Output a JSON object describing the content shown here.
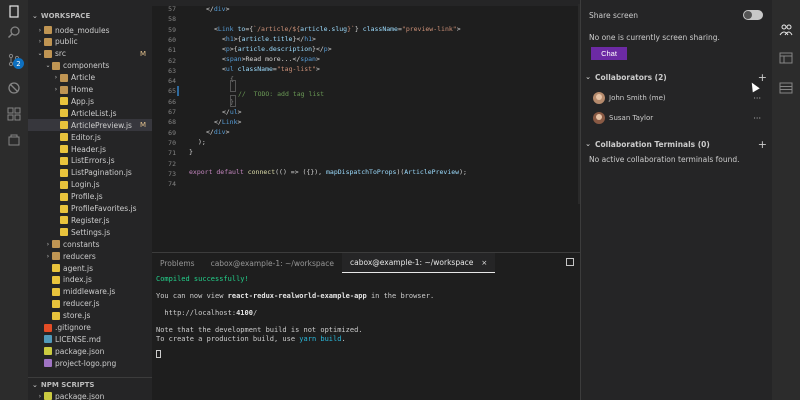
{
  "explorer": {
    "section_title": "WORKSPACE",
    "npm_scripts_title": "NPM SCRIPTS",
    "npm_item": "package.json",
    "items": [
      {
        "label": "node_modules",
        "type": "folder",
        "indent": 1,
        "chev": "›"
      },
      {
        "label": "public",
        "type": "folder",
        "indent": 1,
        "chev": "›"
      },
      {
        "label": "src",
        "type": "folder",
        "indent": 1,
        "chev": "⌄"
      },
      {
        "label": "components",
        "type": "folder",
        "indent": 2,
        "chev": "⌄"
      },
      {
        "label": "Article",
        "type": "folder",
        "indent": 3,
        "chev": "›"
      },
      {
        "label": "Home",
        "type": "folder",
        "indent": 3,
        "chev": "›"
      },
      {
        "label": "App.js",
        "type": "js",
        "indent": 3
      },
      {
        "label": "ArticleList.js",
        "type": "js",
        "indent": 3
      },
      {
        "label": "ArticlePreview.js",
        "type": "js",
        "indent": 3,
        "selected": true
      },
      {
        "label": "Editor.js",
        "type": "js",
        "indent": 3
      },
      {
        "label": "Header.js",
        "type": "js",
        "indent": 3
      },
      {
        "label": "ListErrors.js",
        "type": "js",
        "indent": 3
      },
      {
        "label": "ListPagination.js",
        "type": "js",
        "indent": 3
      },
      {
        "label": "Login.js",
        "type": "js",
        "indent": 3
      },
      {
        "label": "Profile.js",
        "type": "js",
        "indent": 3
      },
      {
        "label": "ProfileFavorites.js",
        "type": "js",
        "indent": 3
      },
      {
        "label": "Register.js",
        "type": "js",
        "indent": 3
      },
      {
        "label": "Settings.js",
        "type": "js",
        "indent": 3
      },
      {
        "label": "constants",
        "type": "folder",
        "indent": 2,
        "chev": "›"
      },
      {
        "label": "reducers",
        "type": "folder",
        "indent": 2,
        "chev": "›"
      },
      {
        "label": "agent.js",
        "type": "js",
        "indent": 2
      },
      {
        "label": "index.js",
        "type": "js",
        "indent": 2
      },
      {
        "label": "middleware.js",
        "type": "js",
        "indent": 2
      },
      {
        "label": "reducer.js",
        "type": "js",
        "indent": 2
      },
      {
        "label": "store.js",
        "type": "js",
        "indent": 2
      },
      {
        "label": ".gitignore",
        "type": "git",
        "indent": 1
      },
      {
        "label": "LICENSE.md",
        "type": "md",
        "indent": 1
      },
      {
        "label": "package.json",
        "type": "json",
        "indent": 1
      },
      {
        "label": "project-logo.png",
        "type": "png",
        "indent": 1
      }
    ],
    "modified_mark": "M",
    "badge_count": "2"
  },
  "editor": {
    "line_numbers": [
      "57",
      "58",
      "59",
      "60",
      "61",
      "62",
      "63",
      "64",
      "65",
      "66",
      "67",
      "68",
      "69",
      "70",
      "71",
      "72",
      "73",
      "74"
    ]
  },
  "panel": {
    "tabs": [
      {
        "label": "Problems"
      },
      {
        "label": "cabox@example-1: ~/workspace"
      },
      {
        "label": "cabox@example-1: ~/workspace",
        "active": true,
        "close": "×"
      }
    ],
    "terminal": {
      "compiled": "Compiled successfully!",
      "view_prefix": "You can now view ",
      "app_name": "react-redux-realworld-example-app",
      "view_suffix": " in the browser.",
      "url_prefix": "  http://localhost:",
      "port": "4100",
      "url_suffix": "/",
      "note1": "Note that the development build is not optimized.",
      "note2_prefix": "To create a production build, use ",
      "note2_cmd": "yarn build",
      "note2_suffix": "."
    }
  },
  "collab": {
    "share_screen": "Share screen",
    "no_sharing": "No one is currently screen sharing.",
    "chat_button": "Chat",
    "collaborators_title": "Collaborators (2)",
    "collaborators": [
      {
        "name": "John Smith (me)"
      },
      {
        "name": "Susan Taylor"
      }
    ],
    "terminals_title": "Collaboration Terminals (0)",
    "no_terminals": "No active collaboration terminals found.",
    "dots": "···",
    "plus": "+"
  }
}
